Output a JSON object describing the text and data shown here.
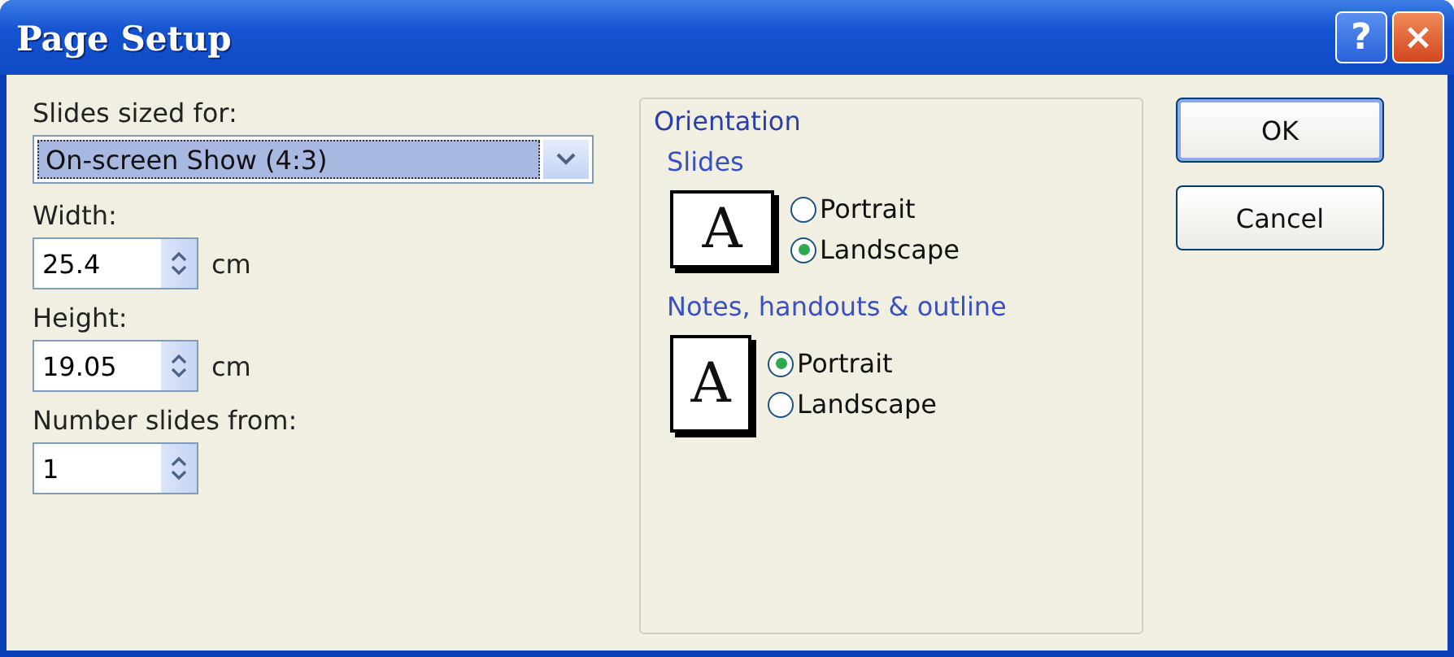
{
  "window": {
    "title": "Page Setup",
    "help_button": "?",
    "close_button": "×"
  },
  "slides_sized_for": {
    "label": "Slides sized for:",
    "value": "On-screen Show (4:3)"
  },
  "width": {
    "label": "Width:",
    "value": "25.4",
    "unit": "cm"
  },
  "height": {
    "label": "Height:",
    "value": "19.05",
    "unit": "cm"
  },
  "number_slides_from": {
    "label": "Number slides from:",
    "value": "1"
  },
  "orientation": {
    "title": "Orientation",
    "groups": [
      {
        "title": "Slides",
        "icon_glyph": "A",
        "kind": "landscape",
        "options": [
          {
            "label": "Portrait",
            "selected": false
          },
          {
            "label": "Landscape",
            "selected": true
          }
        ]
      },
      {
        "title": "Notes, handouts & outline",
        "icon_glyph": "A",
        "kind": "portrait",
        "options": [
          {
            "label": "Portrait",
            "selected": true
          },
          {
            "label": "Landscape",
            "selected": false
          }
        ]
      }
    ]
  },
  "buttons": [
    {
      "label": "OK",
      "default": true
    },
    {
      "label": "Cancel",
      "default": false
    }
  ]
}
